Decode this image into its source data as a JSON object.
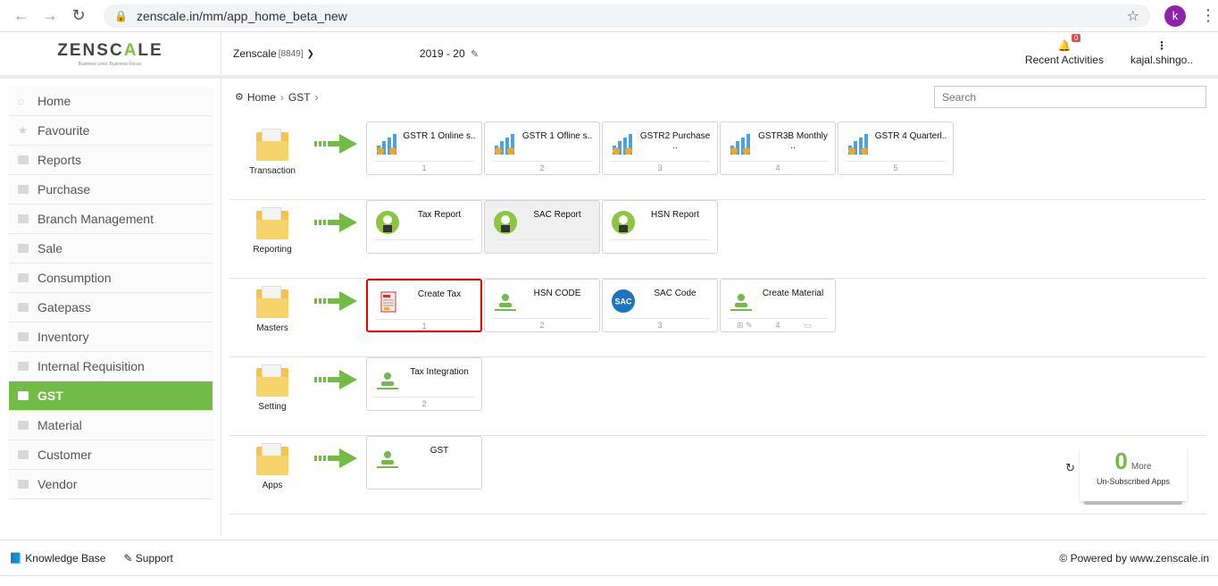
{
  "browser": {
    "url": "zenscale.in/mm/app_home_beta_new",
    "avatar_letter": "k"
  },
  "header": {
    "logo_pre": "ZENSC",
    "logo_accent": "A",
    "logo_post": "LE",
    "logo_tagline": "Business Less. Business Focus.",
    "company": "Zenscale",
    "company_code": "[8849]",
    "fiscal_year": "2019 - 20",
    "notifications_count": "0",
    "recent_label": "Recent Activities",
    "user_label": "kajal.shingo.."
  },
  "sidebar": {
    "items": [
      {
        "label": "Home"
      },
      {
        "label": "Favourite"
      },
      {
        "label": "Reports"
      },
      {
        "label": "Purchase"
      },
      {
        "label": "Branch Management"
      },
      {
        "label": "Sale"
      },
      {
        "label": "Consumption"
      },
      {
        "label": "Gatepass"
      },
      {
        "label": "Inventory"
      },
      {
        "label": "Internal Requisition"
      },
      {
        "label": "GST"
      },
      {
        "label": "Material"
      },
      {
        "label": "Customer"
      },
      {
        "label": "Vendor"
      }
    ]
  },
  "breadcrumb": {
    "home": "Home",
    "current": "GST"
  },
  "search": {
    "placeholder": "Search"
  },
  "groups": [
    {
      "label": "Transaction",
      "tiles": [
        {
          "label": "GSTR 1 Online s..",
          "num": "1"
        },
        {
          "label": "GSTR 1 Ofline s..",
          "num": "2"
        },
        {
          "label": "GSTR2 Purchase ..",
          "num": "3"
        },
        {
          "label": "GSTR3B Monthly ..",
          "num": "4"
        },
        {
          "label": "GSTR 4 Quarterl..",
          "num": "5"
        }
      ]
    },
    {
      "label": "Reporting",
      "tiles": [
        {
          "label": "Tax Report",
          "num": ""
        },
        {
          "label": "SAC Report",
          "num": ""
        },
        {
          "label": "HSN Report",
          "num": ""
        }
      ]
    },
    {
      "label": "Masters",
      "tiles": [
        {
          "label": "Create Tax",
          "num": "1"
        },
        {
          "label": "HSN CODE",
          "num": "2"
        },
        {
          "label": "SAC Code",
          "num": "3",
          "icon_text": "SAC"
        },
        {
          "label": "Create Material",
          "num": "4"
        }
      ]
    },
    {
      "label": "Setting",
      "tiles": [
        {
          "label": "Tax Integration",
          "num": "2"
        }
      ]
    },
    {
      "label": "Apps",
      "tiles": [
        {
          "label": "GST",
          "num": ""
        }
      ]
    }
  ],
  "unsubscribed": {
    "count": "0",
    "more": "More",
    "label": "Un-Subscribed Apps"
  },
  "footer": {
    "knowledge_base": "Knowledge Base",
    "support": "Support",
    "powered": "© Powered by www.zenscale.in"
  },
  "colors": {
    "accent": "#73bb47",
    "selected_border": "#e00000",
    "badge": "#d9534f"
  }
}
